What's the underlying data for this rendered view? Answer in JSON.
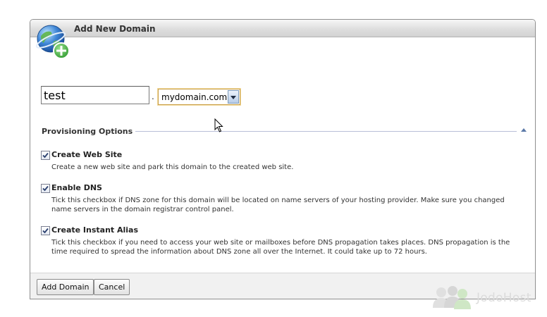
{
  "dialog": {
    "title": "Add New Domain",
    "icon": "globe-add-icon"
  },
  "form": {
    "name_value": "test",
    "separator": ".",
    "domain_selected": "mydomain.com"
  },
  "provisioning": {
    "title": "Provisioning Options",
    "options": [
      {
        "label": "Create Web Site",
        "checked": true,
        "description": "Create a new web site and park this domain to the created web site."
      },
      {
        "label": "Enable DNS",
        "checked": true,
        "description": "Tick this checkbox if DNS zone for this domain will be located on name servers of your hosting provider. Make sure you changed name servers in the domain registrar control panel."
      },
      {
        "label": "Create Instant Alias",
        "checked": true,
        "description": "Tick this checkbox if you need to access your web site or mailboxes before DNS propagation takes places. DNS propagation is the time required to spread the information about DNS zone all over the Internet. It could take up to 72 hours."
      }
    ]
  },
  "buttons": {
    "add_domain": "Add Domain",
    "cancel": "Cancel"
  },
  "watermark": {
    "text": "JodoHost"
  },
  "colors": {
    "accent_green": "#3aa53a",
    "globe_blue": "#2f6fc4",
    "section_arrow": "#5b79a8"
  }
}
